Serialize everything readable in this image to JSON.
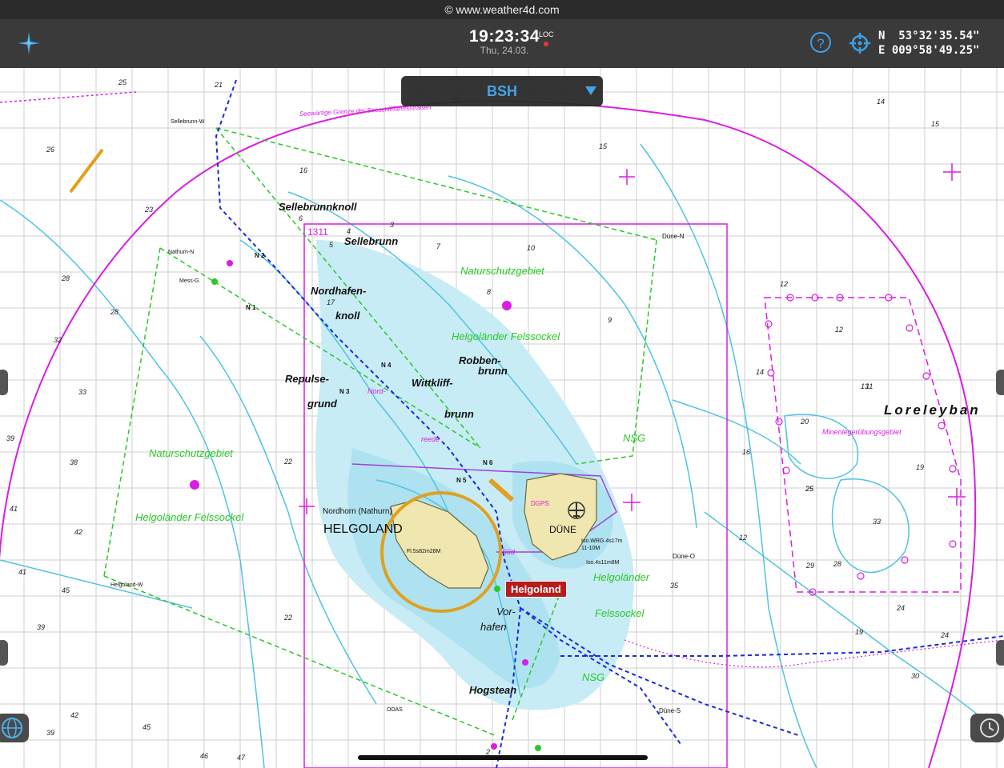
{
  "copyright": "© www.weather4d.com",
  "header": {
    "time": "19:23:34",
    "time_suffix": "LOC",
    "date": "Thu, 24.03.",
    "help_label": "?",
    "coords": {
      "lat": "N  53°32'35.54\"",
      "lon": "E 009°58'49.25\""
    }
  },
  "layer_selector": {
    "value": "BSH"
  },
  "marker": {
    "label": "Helgoland"
  },
  "chart_labels": {
    "island": "HELGOLAND",
    "dune": "DÜNE",
    "nordhorn": "Nordhorn (Nathurn)",
    "sellebrunnknoll": "Sellebrunnknoll",
    "sellebrunn": "Sellebrunn",
    "nordhafen": "Nordhafen-",
    "knoll": "knoll",
    "repulse": "Repulse-",
    "grund": "grund",
    "wittkliff": "Wittkliff-",
    "brunn": "brunn",
    "robben": "Robben-",
    "robbenbrunn": "brunn",
    "hogstean": "Hogstean",
    "vorhafen_a": "Vor-",
    "vorhafen_b": "hafen",
    "loreley": "Loreleyban",
    "ns1": "Naturschutzgebiet",
    "ns2": "Naturschutzgebiet",
    "felssockel1": "Helgoländer Felssockel",
    "felssockel2": "Helgoländer Felssockel",
    "hf_a": "Helgoländer",
    "hf_b": "Felssockel",
    "nsg1": "NSG",
    "nsg2": "NSG",
    "area_1311": "1311",
    "minen": "Minenlegerübungsgebiet",
    "seegrenze": "Seewärtige Grenze der Seeschifffahrtsstraßen",
    "dgps": "DGPS",
    "buoy_n1": "N 1",
    "buoy_n2": "N 2",
    "buoy_n3": "N 3",
    "buoy_n4": "N 4",
    "buoy_n5": "N 5",
    "buoy_n6": "N 6",
    "duene_n": "Düne-N",
    "duene_o": "Düne-O",
    "duene_s": "Düne-S",
    "sellebrunn_w": "Sellebrunn-W",
    "nathurn_n": "Nathurn-N",
    "helgoland_w": "Helgoland-W",
    "mess_g": "Mess-G.",
    "light_main": "Fl.5s82m28M",
    "light_iso1": "Iso.WRG.4s17m",
    "light_iso1b": "11-10M",
    "light_iso2": "Iso.4s11m8M",
    "odas": "ODAS",
    "nord_reede": "Nord-",
    "reede": "reede",
    "sued": "Süd-",
    "depths": [
      "25",
      "21",
      "26",
      "23",
      "28",
      "28",
      "32",
      "33",
      "39",
      "38",
      "41",
      "42",
      "45",
      "41",
      "39",
      "42",
      "39",
      "45",
      "46",
      "47",
      "22",
      "22",
      "14",
      "15",
      "12",
      "11",
      "12",
      "20",
      "19",
      "19",
      "25",
      "28",
      "33",
      "30",
      "24",
      "16",
      "14",
      "13",
      "12",
      "10",
      "9",
      "8",
      "7",
      "6",
      "5",
      "4",
      "3",
      "2",
      "18",
      "17",
      "16",
      "15",
      "29",
      "25",
      "24",
      "35"
    ]
  },
  "colors": {
    "water_shallow": "#c8ecf5",
    "water_mid": "#aee2f0",
    "depth_contour": "#4fc3e0",
    "land": "#f0e6b0",
    "magenta": "#d81ee0",
    "green_dashed": "#28c828",
    "route_blue": "#1a2ad8",
    "accent_blue": "#3aa0e8",
    "orange_circle": "#e0a020"
  }
}
